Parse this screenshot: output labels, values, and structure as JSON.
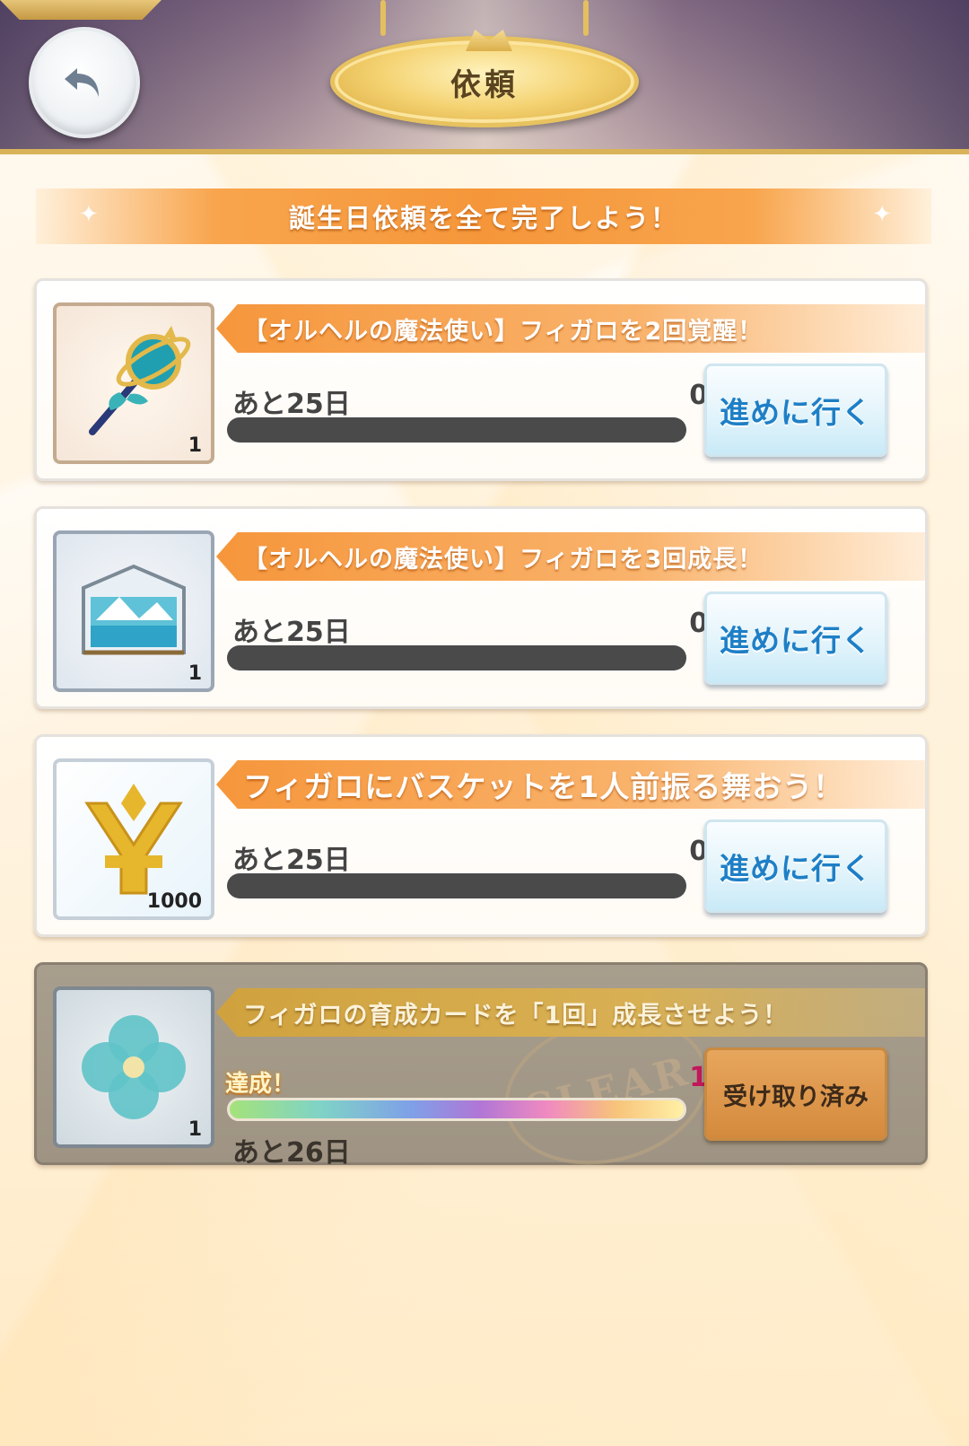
{
  "header": {
    "title": "依頼",
    "back_icon": "back-arrow-icon"
  },
  "banner": {
    "text": "誕生日依頼を全て完了しよう！"
  },
  "quests": [
    {
      "title": "【オルヘルの魔法使い】フィガロを2回覚醒！",
      "days_left": "あと25日",
      "progress": "0/2",
      "progress_fraction": 0,
      "reward_icon": "magic-staff-icon",
      "reward_count": "1",
      "button_label": "進めに行く",
      "status": "in-progress"
    },
    {
      "title": "【オルヘルの魔法使い】フィガロを3回成長！",
      "days_left": "あと25日",
      "progress": "0/3",
      "progress_fraction": 0,
      "reward_icon": "snow-globe-box-icon",
      "reward_count": "1",
      "button_label": "進めに行く",
      "status": "in-progress"
    },
    {
      "title": "フィガロにバスケットを1人前振る舞おう！",
      "days_left": "あと25日",
      "progress": "0/1",
      "progress_fraction": 0,
      "reward_icon": "gold-currency-icon",
      "reward_count": "1000",
      "button_label": "進めに行く",
      "status": "in-progress"
    },
    {
      "title": "フィガロの育成カードを「1回」成長させよう！",
      "achieved_label": "達成！",
      "days_left": "あと26日",
      "progress": "1/1",
      "progress_fraction": 1,
      "reward_icon": "blue-flower-icon",
      "reward_count": "1",
      "button_label": "受け取り済み",
      "status": "cleared"
    }
  ],
  "colors": {
    "accent_orange": "#f6963b",
    "button_blue_text": "#1e7fc6",
    "progress_track": "#4a4a4a",
    "cleared_card": "#a89e8d",
    "claimed_button": "#d48a3d"
  }
}
